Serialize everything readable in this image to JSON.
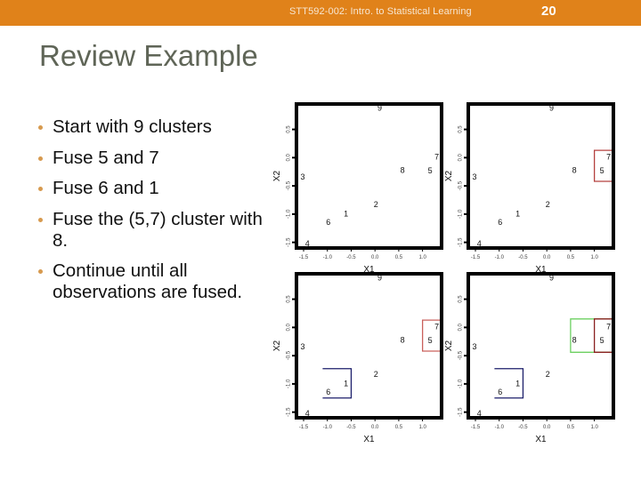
{
  "header": {
    "course_title": "STT592-002: Intro. to Statistical Learning",
    "slide_number": "20",
    "bar_color": "#E0821A"
  },
  "slide": {
    "title": "Review Example",
    "bullets": [
      "Start with 9 clusters",
      "Fuse 5 and 7",
      "Fuse 6 and 1",
      "Fuse the (5,7) cluster with 8.",
      "Continue until all observations are fused."
    ]
  },
  "chart_data": [
    {
      "type": "scatter",
      "title": "",
      "xlabel": "X1",
      "ylabel": "X2",
      "xticks": [
        "-1.5",
        "-1.0",
        "-0.5",
        "0.0",
        "0.5",
        "1.0"
      ],
      "yticks": [
        "-1.5",
        "-1.0",
        "-0.5",
        "0.0",
        "0.5"
      ],
      "xlim": [
        -1.65,
        1.4
      ],
      "ylim": [
        -1.6,
        0.95
      ],
      "points": [
        {
          "label": "1",
          "x": -0.61,
          "y": -1.0
        },
        {
          "label": "2",
          "x": 0.02,
          "y": -0.84
        },
        {
          "label": "3",
          "x": -1.52,
          "y": -0.35
        },
        {
          "label": "4",
          "x": -1.42,
          "y": -1.53
        },
        {
          "label": "5",
          "x": 1.16,
          "y": -0.24
        },
        {
          "label": "6",
          "x": -0.98,
          "y": -1.15
        },
        {
          "label": "7",
          "x": 1.3,
          "y": 0.0
        },
        {
          "label": "8",
          "x": 0.58,
          "y": -0.23
        },
        {
          "label": "9",
          "x": 0.1,
          "y": 0.87
        }
      ],
      "clusters": []
    },
    {
      "type": "scatter",
      "title": "",
      "xlabel": "X1",
      "ylabel": "X2",
      "xticks": [
        "-1.5",
        "-1.0",
        "-0.5",
        "0.0",
        "0.5",
        "1.0"
      ],
      "yticks": [
        "-1.5",
        "-1.0",
        "-0.5",
        "0.0",
        "0.5"
      ],
      "xlim": [
        -1.65,
        1.4
      ],
      "ylim": [
        -1.6,
        0.95
      ],
      "points": [
        {
          "label": "1",
          "x": -0.61,
          "y": -1.0
        },
        {
          "label": "2",
          "x": 0.02,
          "y": -0.84
        },
        {
          "label": "3",
          "x": -1.52,
          "y": -0.35
        },
        {
          "label": "4",
          "x": -1.42,
          "y": -1.53
        },
        {
          "label": "5",
          "x": 1.16,
          "y": -0.24
        },
        {
          "label": "6",
          "x": -0.98,
          "y": -1.15
        },
        {
          "label": "7",
          "x": 1.3,
          "y": 0.0
        },
        {
          "label": "8",
          "x": 0.58,
          "y": -0.23
        },
        {
          "label": "9",
          "x": 0.1,
          "y": 0.87
        }
      ],
      "clusters": [
        {
          "members": [
            "5",
            "7"
          ],
          "color": "#b5413f",
          "x0": 1.0,
          "x1": 1.4,
          "y0": -0.42,
          "y1": 0.13,
          "open_right": true
        }
      ]
    },
    {
      "type": "scatter",
      "title": "",
      "xlabel": "X1",
      "ylabel": "X2",
      "xticks": [
        "-1.5",
        "-1.0",
        "-0.5",
        "0.0",
        "0.5",
        "1.0"
      ],
      "yticks": [
        "-1.5",
        "-1.0",
        "-0.5",
        "0.0",
        "0.5"
      ],
      "xlim": [
        -1.65,
        1.4
      ],
      "ylim": [
        -1.6,
        0.95
      ],
      "points": [
        {
          "label": "1",
          "x": -0.61,
          "y": -1.0
        },
        {
          "label": "2",
          "x": 0.02,
          "y": -0.84
        },
        {
          "label": "3",
          "x": -1.52,
          "y": -0.35
        },
        {
          "label": "4",
          "x": -1.42,
          "y": -1.53
        },
        {
          "label": "5",
          "x": 1.16,
          "y": -0.24
        },
        {
          "label": "6",
          "x": -0.98,
          "y": -1.15
        },
        {
          "label": "7",
          "x": 1.3,
          "y": 0.0
        },
        {
          "label": "8",
          "x": 0.58,
          "y": -0.23
        },
        {
          "label": "9",
          "x": 0.1,
          "y": 0.87
        }
      ],
      "clusters": [
        {
          "members": [
            "5",
            "7"
          ],
          "color": "#c9605c",
          "x0": 1.0,
          "x1": 1.4,
          "y0": -0.42,
          "y1": 0.13,
          "open_right": true
        },
        {
          "members": [
            "6",
            "1"
          ],
          "color": "#1c1f6b",
          "x0": -1.1,
          "x1": -0.5,
          "y0": -1.25,
          "y1": -0.73,
          "open_left": true
        }
      ]
    },
    {
      "type": "scatter",
      "title": "",
      "xlabel": "X1",
      "ylabel": "X2",
      "xticks": [
        "-1.5",
        "-1.0",
        "-0.5",
        "0.0",
        "0.5",
        "1.0"
      ],
      "yticks": [
        "-1.5",
        "-1.0",
        "-0.5",
        "0.0",
        "0.5"
      ],
      "xlim": [
        -1.65,
        1.4
      ],
      "ylim": [
        -1.6,
        0.95
      ],
      "points": [
        {
          "label": "1",
          "x": -0.61,
          "y": -1.0
        },
        {
          "label": "2",
          "x": 0.02,
          "y": -0.84
        },
        {
          "label": "3",
          "x": -1.52,
          "y": -0.35
        },
        {
          "label": "4",
          "x": -1.42,
          "y": -1.53
        },
        {
          "label": "5",
          "x": 1.16,
          "y": -0.24
        },
        {
          "label": "6",
          "x": -0.98,
          "y": -1.15
        },
        {
          "label": "7",
          "x": 1.3,
          "y": 0.0
        },
        {
          "label": "8",
          "x": 0.58,
          "y": -0.23
        },
        {
          "label": "9",
          "x": 0.1,
          "y": 0.87
        }
      ],
      "clusters": [
        {
          "members": [
            "5",
            "7",
            "8"
          ],
          "color": "#6cd060",
          "x0": 0.5,
          "x1": 1.45,
          "y0": -0.44,
          "y1": 0.15
        },
        {
          "members": [
            "5",
            "7"
          ],
          "color": "#8a2020",
          "x0": 1.0,
          "x1": 1.45,
          "y0": -0.44,
          "y1": 0.15,
          "open_right": true
        },
        {
          "members": [
            "6",
            "1"
          ],
          "color": "#1c1f6b",
          "x0": -1.1,
          "x1": -0.5,
          "y0": -1.25,
          "y1": -0.73,
          "open_right": false,
          "open_left": true
        }
      ]
    }
  ]
}
